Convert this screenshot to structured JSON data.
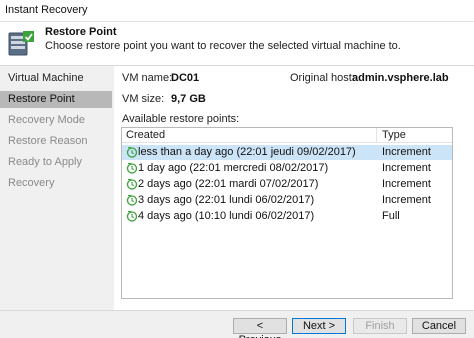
{
  "window": {
    "title": "Instant Recovery"
  },
  "header": {
    "title": "Restore Point",
    "subtitle": "Choose restore point you want to recover the selected virtual machine to.",
    "icon": "server-restore-icon"
  },
  "sidebar": {
    "items": [
      {
        "label": "Virtual Machine",
        "state": "done"
      },
      {
        "label": "Restore Point",
        "state": "active"
      },
      {
        "label": "Recovery Mode",
        "state": "pending"
      },
      {
        "label": "Restore Reason",
        "state": "pending"
      },
      {
        "label": "Ready to Apply",
        "state": "pending"
      },
      {
        "label": "Recovery",
        "state": "pending"
      }
    ]
  },
  "vm": {
    "name_label": "VM name:",
    "name": "DC01",
    "host_label": "Original host:",
    "host": "admin.vsphere.lab",
    "size_label": "VM size:",
    "size": "9,7 GB"
  },
  "restore_points": {
    "label": "Available restore points:",
    "columns": [
      "Created",
      "Type"
    ],
    "rows": [
      {
        "created": "less than a day ago (22:01 jeudi 09/02/2017)",
        "type": "Increment",
        "selected": true
      },
      {
        "created": "1 day ago (22:01 mercredi 08/02/2017)",
        "type": "Increment",
        "selected": false
      },
      {
        "created": "2 days ago (22:01 mardi 07/02/2017)",
        "type": "Increment",
        "selected": false
      },
      {
        "created": "3 days ago (22:01 lundi 06/02/2017)",
        "type": "Increment",
        "selected": false
      },
      {
        "created": "4 days ago (10:10 lundi 06/02/2017)",
        "type": "Full",
        "selected": false
      }
    ],
    "row_icon": "restore-point-clock-icon"
  },
  "footer": {
    "previous": "< Previous",
    "next": "Next >",
    "finish": "Finish",
    "cancel": "Cancel"
  },
  "colors": {
    "selected_row": "#cce4f7",
    "sidebar_active": "#b8b8b8",
    "icon_green": "#3aa33a",
    "default_button_border": "#0078d7"
  }
}
